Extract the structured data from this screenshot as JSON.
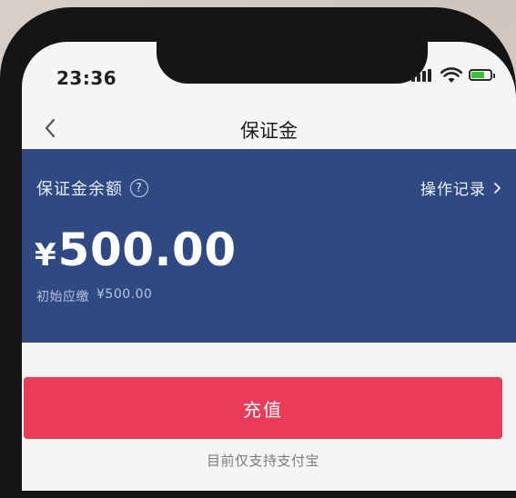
{
  "status_bar": {
    "time": "23:36",
    "battery_level": 0.7,
    "battery_color": "#3cc23a"
  },
  "nav": {
    "title": "保证金",
    "back_icon": "chevron-left-icon"
  },
  "balance": {
    "label": "保证金余额",
    "help_icon_text": "?",
    "records_link": "操作记录",
    "records_icon": "chevron-right-icon",
    "currency_symbol": "¥",
    "amount": "500.00",
    "initial_label": "初始应缴",
    "initial_amount": "¥500.00"
  },
  "actions": {
    "recharge_label": "充值"
  },
  "footnote": "目前仅支持支付宝",
  "colors": {
    "panel": "#2f4a83",
    "accent": "#ea3b58"
  }
}
